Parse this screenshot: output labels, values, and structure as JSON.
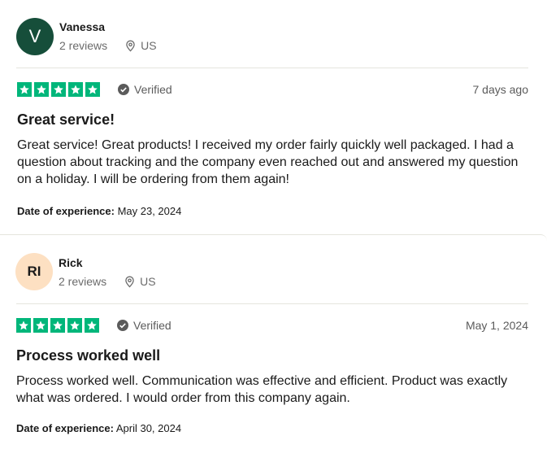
{
  "reviews": [
    {
      "avatar_text": "V",
      "name": "Vanessa",
      "reviews_count": "2 reviews",
      "country": "US",
      "rating": 5,
      "verified_label": "Verified",
      "date": "7 days ago",
      "title": "Great service!",
      "body": "Great service! Great products! I received my order fairly quickly well packaged. I had a question about tracking and the company even reached out and answered my question on a holiday. I will be ordering from them again!",
      "experience_label": "Date of experience:",
      "experience_date": "May 23, 2024"
    },
    {
      "avatar_text": "RI",
      "name": "Rick",
      "reviews_count": "2 reviews",
      "country": "US",
      "rating": 5,
      "verified_label": "Verified",
      "date": "May 1, 2024",
      "title": "Process worked well",
      "body": "Process worked well. Communication was effective and efficient. Product was exactly what was ordered. I would order from this company again.",
      "experience_label": "Date of experience:",
      "experience_date": "April 30, 2024"
    }
  ],
  "colors": {
    "star_green": "#00b67a",
    "avatar_1": "#164e3a",
    "avatar_2": "#fde0c2"
  },
  "icons": {
    "star": "star-icon",
    "location": "location-pin-icon",
    "verified": "verified-check-icon"
  }
}
